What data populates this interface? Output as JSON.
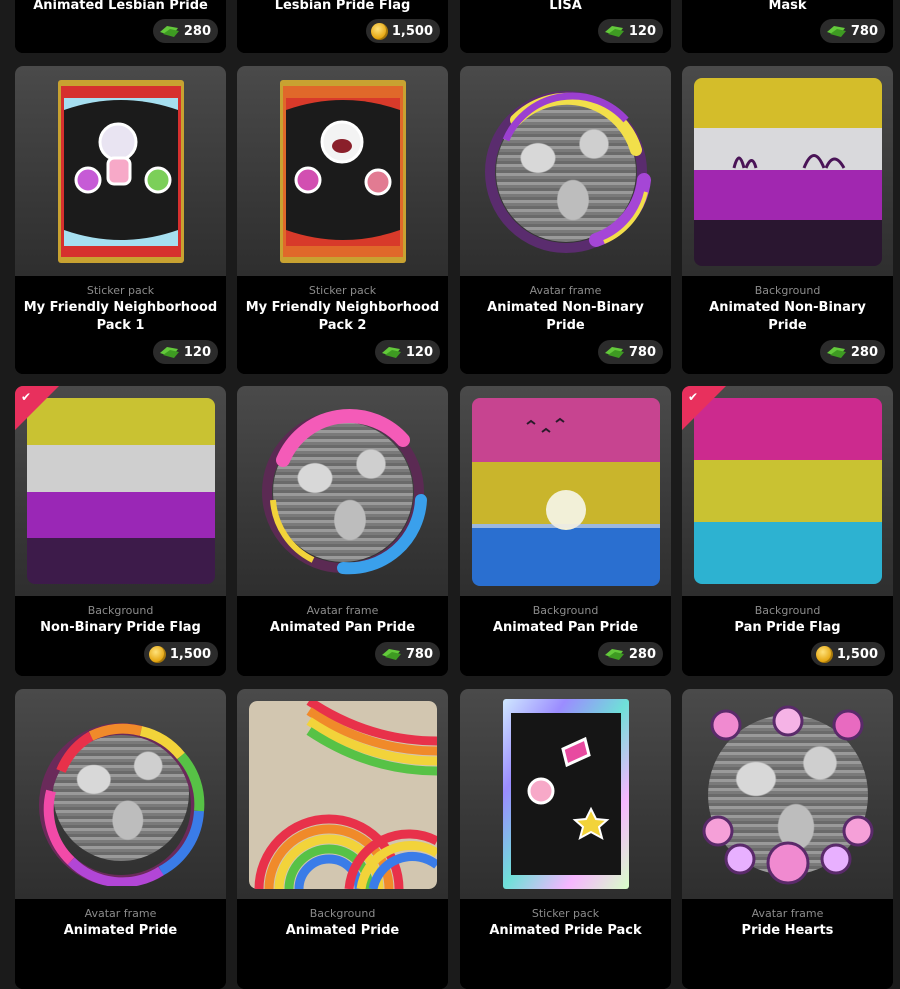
{
  "currency_icons": {
    "gems": "gems-icon",
    "coins": "coin-icon"
  },
  "colors": {
    "accent_ribbon": "#e8305d",
    "card_bg": "#000000",
    "page_bg": "#1b1b1b"
  },
  "row0": [
    {
      "title": "Animated Lesbian Pride",
      "price": "280",
      "currency": "gems"
    },
    {
      "title": "Lesbian Pride Flag",
      "price": "1,500",
      "currency": "coins"
    },
    {
      "title": "LISA",
      "price": "120",
      "currency": "gems"
    },
    {
      "title": "Mask",
      "price": "780",
      "currency": "gems"
    }
  ],
  "row1": [
    {
      "category": "Sticker pack",
      "title": "My Friendly Neighborhood Pack 1",
      "price": "120",
      "currency": "gems"
    },
    {
      "category": "Sticker pack",
      "title": "My Friendly Neighborhood Pack 2",
      "price": "120",
      "currency": "gems"
    },
    {
      "category": "Avatar frame",
      "title": "Animated Non-Binary Pride",
      "price": "780",
      "currency": "gems"
    },
    {
      "category": "Background",
      "title": "Animated Non-Binary Pride",
      "price": "280",
      "currency": "gems"
    }
  ],
  "row2": [
    {
      "category": "Background",
      "title": "Non-Binary Pride Flag",
      "price": "1,500",
      "currency": "coins",
      "owned": true
    },
    {
      "category": "Avatar frame",
      "title": "Animated Pan Pride",
      "price": "780",
      "currency": "gems"
    },
    {
      "category": "Background",
      "title": "Animated Pan Pride",
      "price": "280",
      "currency": "gems"
    },
    {
      "category": "Background",
      "title": "Pan Pride Flag",
      "price": "1,500",
      "currency": "coins",
      "owned": true
    }
  ],
  "row3": [
    {
      "category": "Avatar frame",
      "title": "Animated Pride"
    },
    {
      "category": "Background",
      "title": "Animated Pride"
    },
    {
      "category": "Sticker pack",
      "title": "Animated Pride Pack"
    },
    {
      "category": "Avatar frame",
      "title": "Pride Hearts"
    }
  ]
}
